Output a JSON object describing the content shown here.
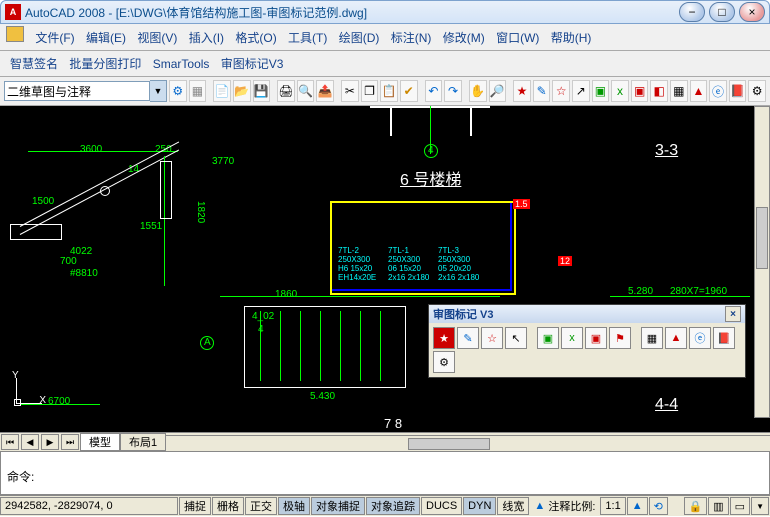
{
  "title": "AutoCAD 2008 - [E:\\DWG\\体育馆结构施工图-审图标记范例.dwg]",
  "menubar": {
    "file": "文件(F)",
    "edit": "编辑(E)",
    "view": "视图(V)",
    "insert": "插入(I)",
    "format": "格式(O)",
    "tools": "工具(T)",
    "draw": "绘图(D)",
    "annotate": "标注(N)",
    "modify": "修改(M)",
    "window": "窗口(W)",
    "help": "帮助(H)"
  },
  "menubar2": {
    "smartSign": "智慧签名",
    "batchPlot": "批量分图打印",
    "smartools": "SmarTools",
    "reviewV3": "审图标记V3"
  },
  "workspace": {
    "value": "二维草图与注释"
  },
  "tabs": {
    "model": "模型",
    "layout1": "布局1"
  },
  "command": {
    "prompt": "命令:"
  },
  "status": {
    "coords": "2942582, -2829074, 0",
    "snap": "捕捉",
    "grid": "栅格",
    "ortho": "正交",
    "polar": "极轴",
    "osnap": "对象捕捉",
    "otrack": "对象追踪",
    "ducs": "DUCS",
    "dyn": "DYN",
    "lweight": "线宽",
    "annoscale": "注释比例:",
    "scale": "1:1"
  },
  "floatpanel": {
    "title": "审图标记 V3"
  },
  "cad": {
    "dim3600": "3600",
    "dim250": "250",
    "dim3770": "3770",
    "dim1500": "1500",
    "dim1820": "1820",
    "dim1551": "1551",
    "dim700": "700",
    "dim4022": "4022",
    "dim8810": "#8810",
    "dim1860": "1860",
    "dim402": "4_02",
    "dim5430": "5.430",
    "dim6700": "6700",
    "dim5280": "5.280",
    "dim280x7": "280X7=1960",
    "txt33": "3-3",
    "txt44": "4-4",
    "txt6stair": "6 号楼梯",
    "txt78": "7 8",
    "txt14": "14",
    "txt4": "4",
    "txtA": "A",
    "tag4c": "4",
    "tag15": "1.5",
    "tag12": "12",
    "tbl1a": "7TL-2",
    "tbl1b": "250X300",
    "tbl1c": "H6 15x20",
    "tbl1d": "EH14x20E",
    "tbl2a": "7TL-1",
    "tbl2b": "250X300",
    "tbl2c": "06 15x20",
    "tbl2d": "2x16 2x180",
    "tbl3a": "7TL-3",
    "tbl3b": "250X300",
    "tbl3c": "05 20x20",
    "tbl3d": "2x16 2x180",
    "ucsY": "Y",
    "ucsX": "X"
  },
  "chart_data": null
}
